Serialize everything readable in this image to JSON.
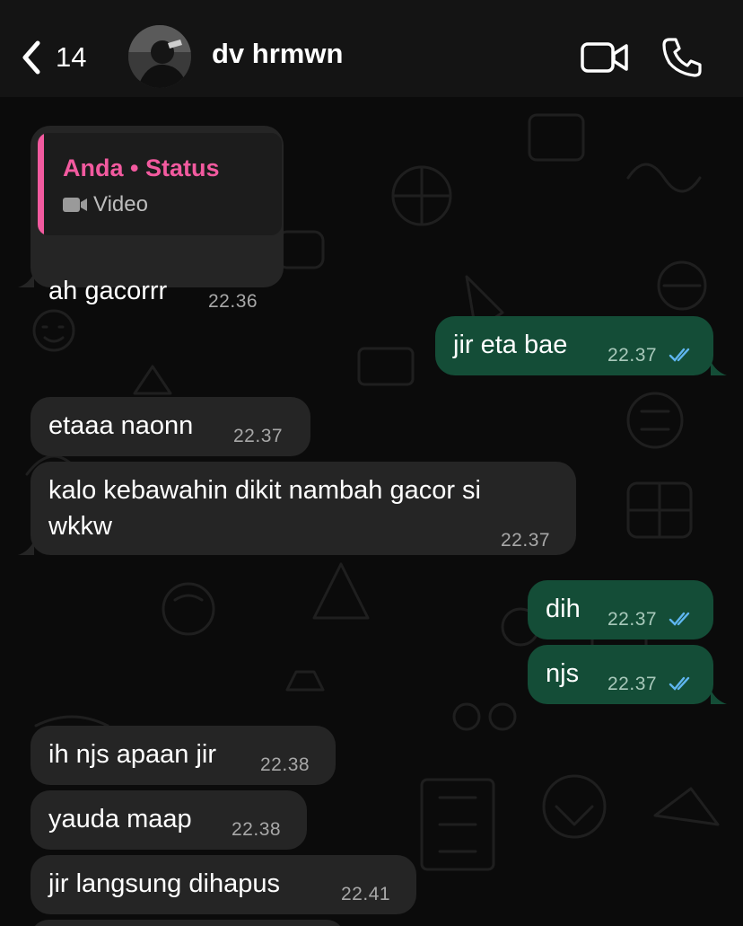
{
  "header": {
    "back_count": "14",
    "contact_name": "dv hrmwn"
  },
  "colors": {
    "incoming_bubble": "#252525",
    "outgoing_bubble": "#144d37",
    "status_accent": "#f25a9f",
    "read_ticks": "#5fb6f0"
  },
  "quote": {
    "title": "Anda • Status",
    "type": "Video"
  },
  "messages": [
    {
      "direction": "in",
      "text": "ah gacorrr",
      "time": "22.36"
    },
    {
      "direction": "out",
      "text": "jir eta bae",
      "time": "22.37",
      "status": "read"
    },
    {
      "direction": "in",
      "text": "etaaa naonn",
      "time": "22.37"
    },
    {
      "direction": "in",
      "text_line1": "kalo kebawahin dikit nambah gacor si",
      "text_line2": "wkkw",
      "time": "22.37"
    },
    {
      "direction": "out",
      "text": "dih",
      "time": "22.37",
      "status": "read"
    },
    {
      "direction": "out",
      "text": "njs",
      "time": "22.37",
      "status": "read"
    },
    {
      "direction": "in",
      "text": "ih njs apaan jir",
      "time": "22.38"
    },
    {
      "direction": "in",
      "text": "yauda maap",
      "time": "22.38"
    },
    {
      "direction": "in",
      "text": "jir langsung dihapus",
      "time": "22.41"
    }
  ]
}
